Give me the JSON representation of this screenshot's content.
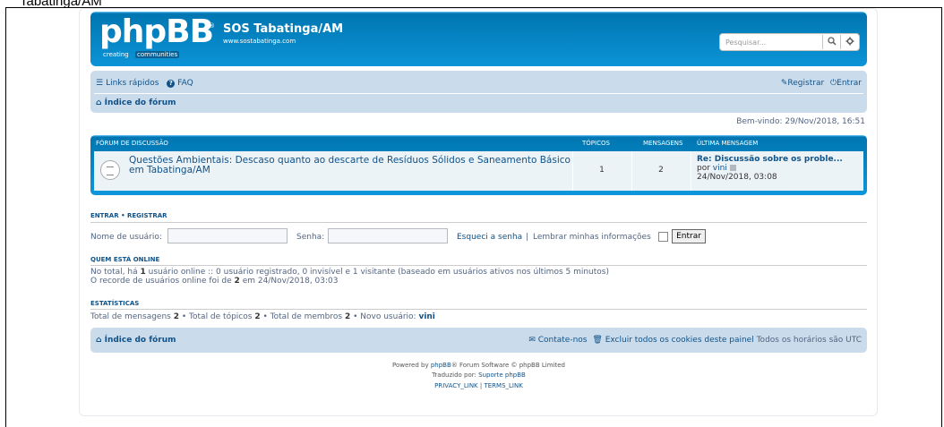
{
  "outer_caption": "Tabatinga/AM",
  "header": {
    "logo_text": "phpBB",
    "logo_reg": "®",
    "logo_tag1": "creating",
    "logo_tag2": "communities",
    "site_title": "SOS Tabatinga/AM",
    "site_url": "www.sostabatinga.com",
    "search_placeholder": "Pesquisar...",
    "search_icon": "search-icon",
    "advanced_icon": "gear-icon"
  },
  "navbar": {
    "quick_links": "Links rápidos",
    "faq": "FAQ",
    "register": "Registrar",
    "login": "Entrar",
    "breadcrumb": "Índice do fórum"
  },
  "welcome": "Bem-vindo: 29/Nov/2018, 16:51",
  "forum_table": {
    "headers": {
      "forum": "FÓRUM DE DISCUSSÃO",
      "topics": "TÓPICOS",
      "posts": "MENSAGENS",
      "last_post": "ÚLTIMA MENSAGEM"
    },
    "rows": [
      {
        "title": "Questões Ambientais: Descaso quanto ao descarte de Resíduos Sólidos e Saneamento Básico em Tabatinga/AM",
        "topics": "1",
        "posts": "2",
        "last_title": "Re: Discussão sobre os proble...",
        "last_by_prefix": "por",
        "last_by_user": "vini",
        "last_date": "24/Nov/2018, 03:08"
      }
    ]
  },
  "login": {
    "section_title": "ENTRAR",
    "section_sep": "•",
    "section_title2": "REGISTRAR",
    "username_label": "Nome de usuário:",
    "password_label": "Senha:",
    "forgot": "Esqueci a senha",
    "separator": "|",
    "remember": "Lembrar minhas informações",
    "submit": "Entrar"
  },
  "online": {
    "section_title": "QUEM ESTÁ ONLINE",
    "line1_prefix": "No total, há",
    "line1_count": "1",
    "line1_suffix": "usuário online :: 0 usuário registrado, 0 invisível e 1 visitante (baseado em usuários ativos nos últimos 5 minutos)",
    "line2_prefix": "O recorde de usuários online foi de",
    "line2_count": "2",
    "line2_suffix": "em 24/Nov/2018, 03:03"
  },
  "stats": {
    "section_title": "ESTATÍSTICAS",
    "posts_label": "Total de mensagens",
    "posts_value": "2",
    "topics_label": "• Total de tópicos",
    "topics_value": "2",
    "members_label": "• Total de membros",
    "members_value": "2",
    "newest_label": "• Novo usuário:",
    "newest_value": "vini"
  },
  "footer": {
    "breadcrumb": "Índice do fórum",
    "contact": "Contate-nos",
    "delete_cookies": "Excluir todos os cookies deste painel",
    "timezone": "Todos os horários são UTC",
    "powered_prefix": "Powered by",
    "powered_link": "phpBB",
    "powered_suffix": "® Forum Software © phpBB Limited",
    "translated_prefix": "Traduzido por:",
    "translated_link": "Suporte phpBB",
    "privacy": "PRIVACY_LINK",
    "sep": "|",
    "terms": "TERMS_LINK"
  },
  "colors": {
    "header_blue": "#12a3eb",
    "navbar_bg": "#cadceb",
    "link": "#105289",
    "row_bg": "#ecf3f7"
  }
}
